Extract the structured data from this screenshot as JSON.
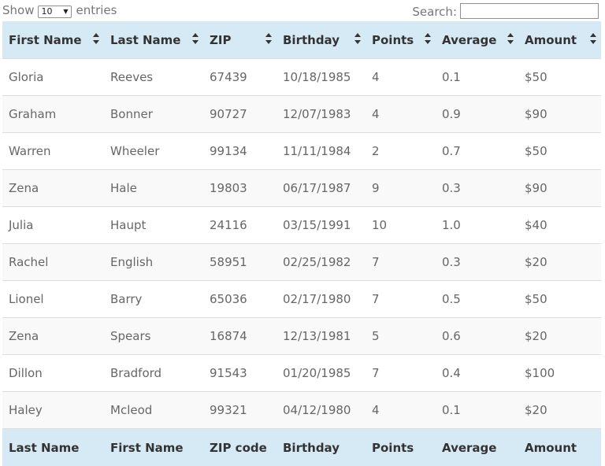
{
  "controls": {
    "show_label": "Show",
    "page_length": "10",
    "entries_label": "entries",
    "search_label": "Search:",
    "search_value": ""
  },
  "table": {
    "headers": [
      "First Name",
      "Last Name",
      "ZIP",
      "Birthday",
      "Points",
      "Average",
      "Amount"
    ],
    "rows": [
      [
        "Gloria",
        "Reeves",
        "67439",
        "10/18/1985",
        "4",
        "0.1",
        "$50"
      ],
      [
        "Graham",
        "Bonner",
        "90727",
        "12/07/1983",
        "4",
        "0.9",
        "$90"
      ],
      [
        "Warren",
        "Wheeler",
        "99134",
        "11/11/1984",
        "2",
        "0.7",
        "$50"
      ],
      [
        "Zena",
        "Hale",
        "19803",
        "06/17/1987",
        "9",
        "0.3",
        "$90"
      ],
      [
        "Julia",
        "Haupt",
        "24116",
        "03/15/1991",
        "10",
        "1.0",
        "$40"
      ],
      [
        "Rachel",
        "English",
        "58951",
        "02/25/1982",
        "7",
        "0.3",
        "$20"
      ],
      [
        "Lionel",
        "Barry",
        "65036",
        "02/17/1980",
        "7",
        "0.5",
        "$50"
      ],
      [
        "Zena",
        "Spears",
        "16874",
        "12/13/1981",
        "5",
        "0.6",
        "$20"
      ],
      [
        "Dillon",
        "Bradford",
        "91543",
        "01/20/1985",
        "7",
        "0.4",
        "$100"
      ],
      [
        "Haley",
        "Mcleod",
        "99321",
        "04/12/1980",
        "4",
        "0.1",
        "$20"
      ]
    ],
    "footer": [
      "Last Name",
      "First Name",
      "ZIP code",
      "Birthday",
      "Points",
      "Average",
      "Amount"
    ]
  }
}
